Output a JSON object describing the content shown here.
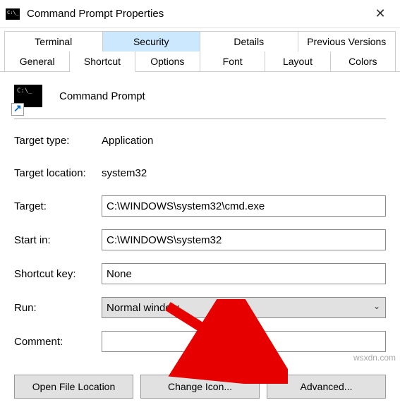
{
  "window": {
    "title": "Command Prompt Properties"
  },
  "tabs": {
    "row1": [
      "Terminal",
      "Security",
      "Details",
      "Previous Versions"
    ],
    "row2": [
      "General",
      "Shortcut",
      "Options",
      "Font",
      "Layout",
      "Colors"
    ],
    "highlighted": "Security",
    "active": "Shortcut"
  },
  "shortcut": {
    "app_name": "Command Prompt",
    "target_type_label": "Target type:",
    "target_type_value": "Application",
    "target_location_label": "Target location:",
    "target_location_value": "system32",
    "target_label": "Target:",
    "target_value": "C:\\WINDOWS\\system32\\cmd.exe",
    "start_in_label": "Start in:",
    "start_in_value": "C:\\WINDOWS\\system32",
    "shortcut_key_label": "Shortcut key:",
    "shortcut_key_value": "None",
    "run_label": "Run:",
    "run_value": "Normal window",
    "comment_label": "Comment:",
    "comment_value": ""
  },
  "buttons": {
    "open_location": "Open File Location",
    "change_icon": "Change Icon...",
    "advanced": "Advanced..."
  },
  "watermark": "wsxdn.com"
}
